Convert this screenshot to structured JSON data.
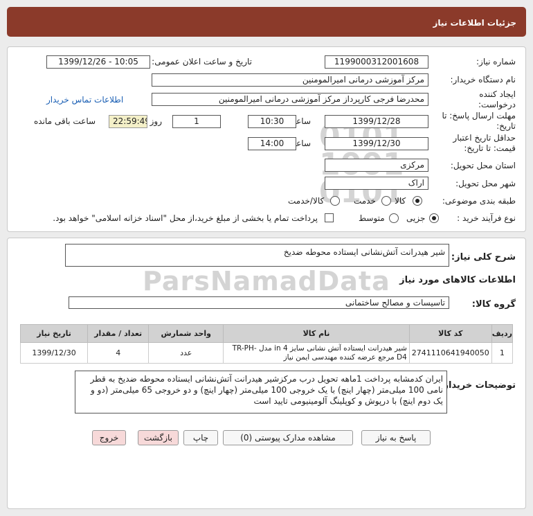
{
  "header": {
    "title": "جزئیات اطلاعات نیاز"
  },
  "form": {
    "need_number_label": "شماره نیاز:",
    "need_number": "1199000312001608",
    "announce_label": "تاریخ و ساعت اعلان عمومی:",
    "announce_value": "1399/12/26 - 10:05",
    "buyer_label": "نام دستگاه خریدار:",
    "buyer": "مرکز آموزشی درمانی امیرالمومنین",
    "creator_label": "ایجاد کننده درخواست:",
    "creator": "محدرضا فرجی کارپرداز مرکز آموزشی درمانی امیرالمومنین",
    "contact_link": "اطلاعات تماس خریدار",
    "deadline_label": "مهلت ارسال پاسخ: تا تاریخ:",
    "deadline_date": "1399/12/28",
    "time_label": "ساعت",
    "deadline_time": "10:30",
    "days": "1",
    "day_label": "روز و",
    "remaining": "22:59:49",
    "remaining_label": "ساعت باقی مانده",
    "validity_label": "حداقل تاریخ اعتبار قیمت: تا تاریخ:",
    "validity_date": "1399/12/30",
    "validity_time": "14:00",
    "province_label": "استان محل تحویل:",
    "province": "مرکزی",
    "city_label": "شهر محل تحویل:",
    "city": "اراک",
    "category_label": "طبقه بندی موضوعی:",
    "category_options": [
      "کالا",
      "خدمت",
      "کالا/خدمت"
    ],
    "category_selected": 0,
    "process_label": "نوع فرآیند خرید :",
    "process_options": [
      "جزیی",
      "متوسط"
    ],
    "process_selected": 0,
    "treasury_note": "پرداخت تمام یا بخشی از مبلغ خرید،از محل \"اسناد خزانه اسلامی\" خواهد بود."
  },
  "details": {
    "summary_label": "شرح کلی نیاز:",
    "summary": "شیر هیدرانت آتش‌نشانی ایستاده محوطه ضدیخ",
    "goods_info_label": "اطلاعات کالاهای مورد نیاز",
    "group_label": "گروه کالا:",
    "group": "تاسیسات و مصالح ساختمانی",
    "table": {
      "headers": [
        "ردیف",
        "کد کالا",
        "نام کالا",
        "واحد شمارش",
        "تعداد / مقدار",
        "تاریخ نیاز"
      ],
      "rows": [
        [
          "1",
          "2741110641940050",
          "شیر هیدرانت ایستاده آتش نشانی سایز 4 in مدل TR-PH-D4 مرجع عرضه کننده مهندسی ایمن نیاز",
          "عدد",
          "4",
          "1399/12/30"
        ]
      ]
    },
    "buyer_notes_label": "توضیحات خریدار:",
    "buyer_notes": "ایران کدمشابه پرداخت 1ماهه تحویل درب مرکزشیر هیدرانت آتش‌نشانی ایستاده محوطه ضدیخ به قطر نامی 100 میلی‌متر (چهار اینچ) با یک خروجی 100 میلی‌متر (چهار اینچ) و دو خروجی 65 میلی‌متر (دو و یک دوم اینچ) با درپوش و کوپلینگ آلومینیومی تایید است"
  },
  "buttons": {
    "reply": "پاسخ به نیاز",
    "attachments": "مشاهده مدارک پیوستی (0)",
    "print": "چاپ",
    "back": "بازگشت",
    "exit": "خروج"
  },
  "watermark": {
    "brand": "ParsNamadData"
  },
  "colors": {
    "header": "#8b3a2a",
    "remaining_bg": "#f4f0c8",
    "link": "#1a5fb4"
  }
}
